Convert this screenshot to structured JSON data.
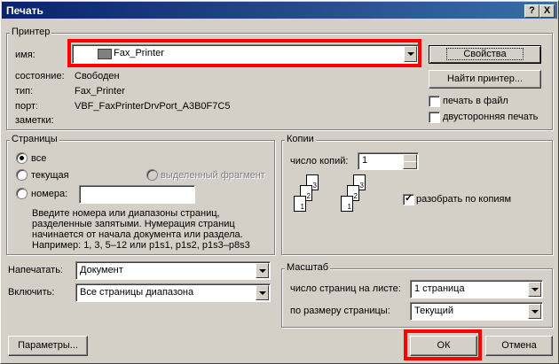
{
  "dialog": {
    "title": "Печать",
    "help_btn": "?",
    "close_btn": "X"
  },
  "printer": {
    "group_title": "Принтер",
    "name_label": "имя:",
    "name_value": "Fax_Printer",
    "status_label": "состояние:",
    "status_value": "Свободен",
    "type_label": "тип:",
    "type_value": "Fax_Printer",
    "port_label": "порт:",
    "port_value": "VBF_FaxPrinterDrvPort_A3B0F7C5",
    "notes_label": "заметки:",
    "properties_btn": "Свойства",
    "find_btn": "Найти принтер...",
    "print_to_file": "печать в файл",
    "duplex": "двусторонняя печать"
  },
  "pages": {
    "group_title": "Страницы",
    "all": "все",
    "current": "текущая",
    "selection": "выделенный фрагмент",
    "numbers": "номера:",
    "hint": [
      "Введите номера или диапазоны страниц,",
      "разделенные запятыми. Нумерация страниц",
      "начинается от начала документа или раздела.",
      "Например: 1, 3, 5–12 или p1s1, p1s2, p1s3–p8s3"
    ]
  },
  "copies": {
    "group_title": "Копии",
    "count_label": "число копий:",
    "count_value": "1",
    "collate": "разобрать по копиям"
  },
  "print_what": {
    "label": "Напечатать:",
    "value": "Документ"
  },
  "include": {
    "label": "Включить:",
    "value": "Все страницы диапазона"
  },
  "zoom": {
    "group_title": "Масштаб",
    "per_sheet_label": "число страниц на листе:",
    "per_sheet_value": "1 страница",
    "scale_label": "по размеру страницы:",
    "scale_value": "Текущий"
  },
  "buttons": {
    "options": "Параметры...",
    "ok": "ОК",
    "cancel": "Отмена"
  }
}
